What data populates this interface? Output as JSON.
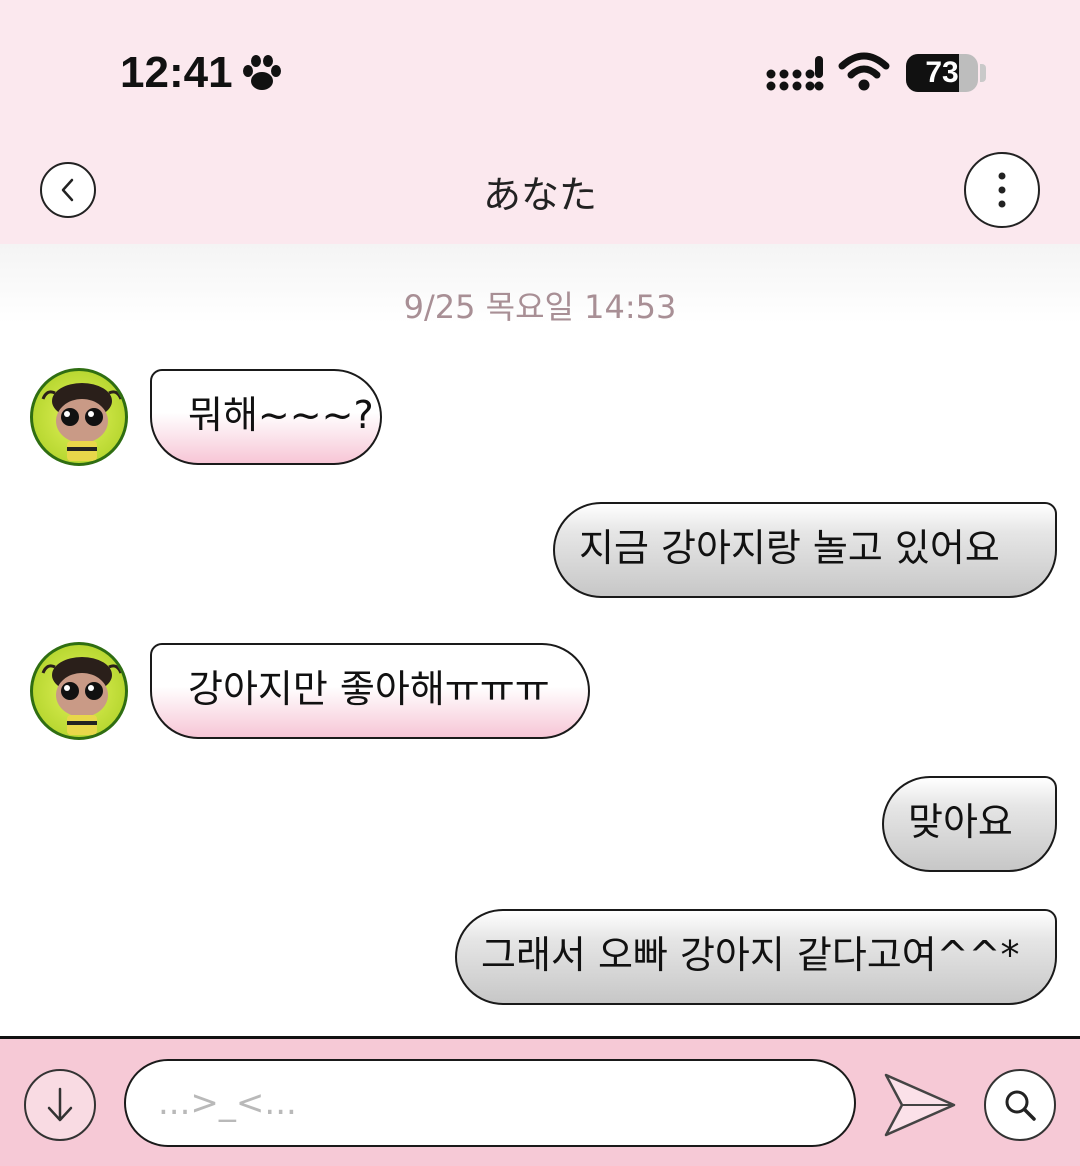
{
  "status_bar": {
    "time": "12:41",
    "battery_level": "73"
  },
  "header": {
    "title": "あなた",
    "icons": {
      "back": "chevron-left-icon",
      "more": "vertical-dots-icon"
    }
  },
  "conversation": {
    "date_stamp": "9/25 목요일 14:53",
    "messages": [
      {
        "direction": "incoming",
        "text": "뭐해~~~?"
      },
      {
        "direction": "outgoing",
        "text": "지금 강아지랑 놀고 있어요"
      },
      {
        "direction": "incoming",
        "text": "강아지만 좋아해ㅠㅠㅠ"
      },
      {
        "direction": "outgoing",
        "text": "맞아요"
      },
      {
        "direction": "outgoing",
        "text": "그래서 오빠 강아지 같다고여^^*"
      }
    ]
  },
  "composer": {
    "placeholder": "...>_<...",
    "icons": {
      "scroll_down": "arrow-down-icon",
      "send": "send-icon",
      "search": "search-icon"
    }
  },
  "colors": {
    "header_bg": "#fbe8ee",
    "composer_bg": "#f6c9d6",
    "incoming_bubble_tint": "#f7c6d6",
    "outgoing_bubble_tint": "#c7c7c7",
    "date_text": "#a88f95"
  }
}
